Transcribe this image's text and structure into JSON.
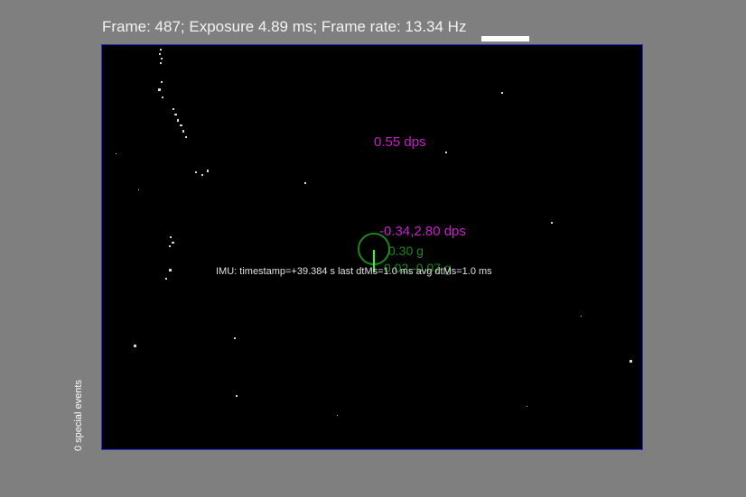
{
  "header": {
    "status_text": "Frame: 487; Exposure 4.89 ms; Frame rate: 13.34 Hz"
  },
  "side": {
    "special_events_label": "0 special events"
  },
  "imu": {
    "rate_text": "0.55 dps",
    "rate_xy_text": "-0.34,2.80 dps",
    "accel_text": "0.30 g",
    "accel_xy_text": "0.02,-0.07 g",
    "info_text": "IMU: timestamp=+39.384  s last dtMs=1.0   ms  avg dtMs=1.0   ms"
  },
  "colors": {
    "background": "#7f7f7f",
    "viewport": "#000000",
    "viewport_border": "#2a2ad8",
    "gyro_text": "#c81ec8",
    "accel_text": "#1a8a1a",
    "accel_vector": "#2bff2b"
  }
}
